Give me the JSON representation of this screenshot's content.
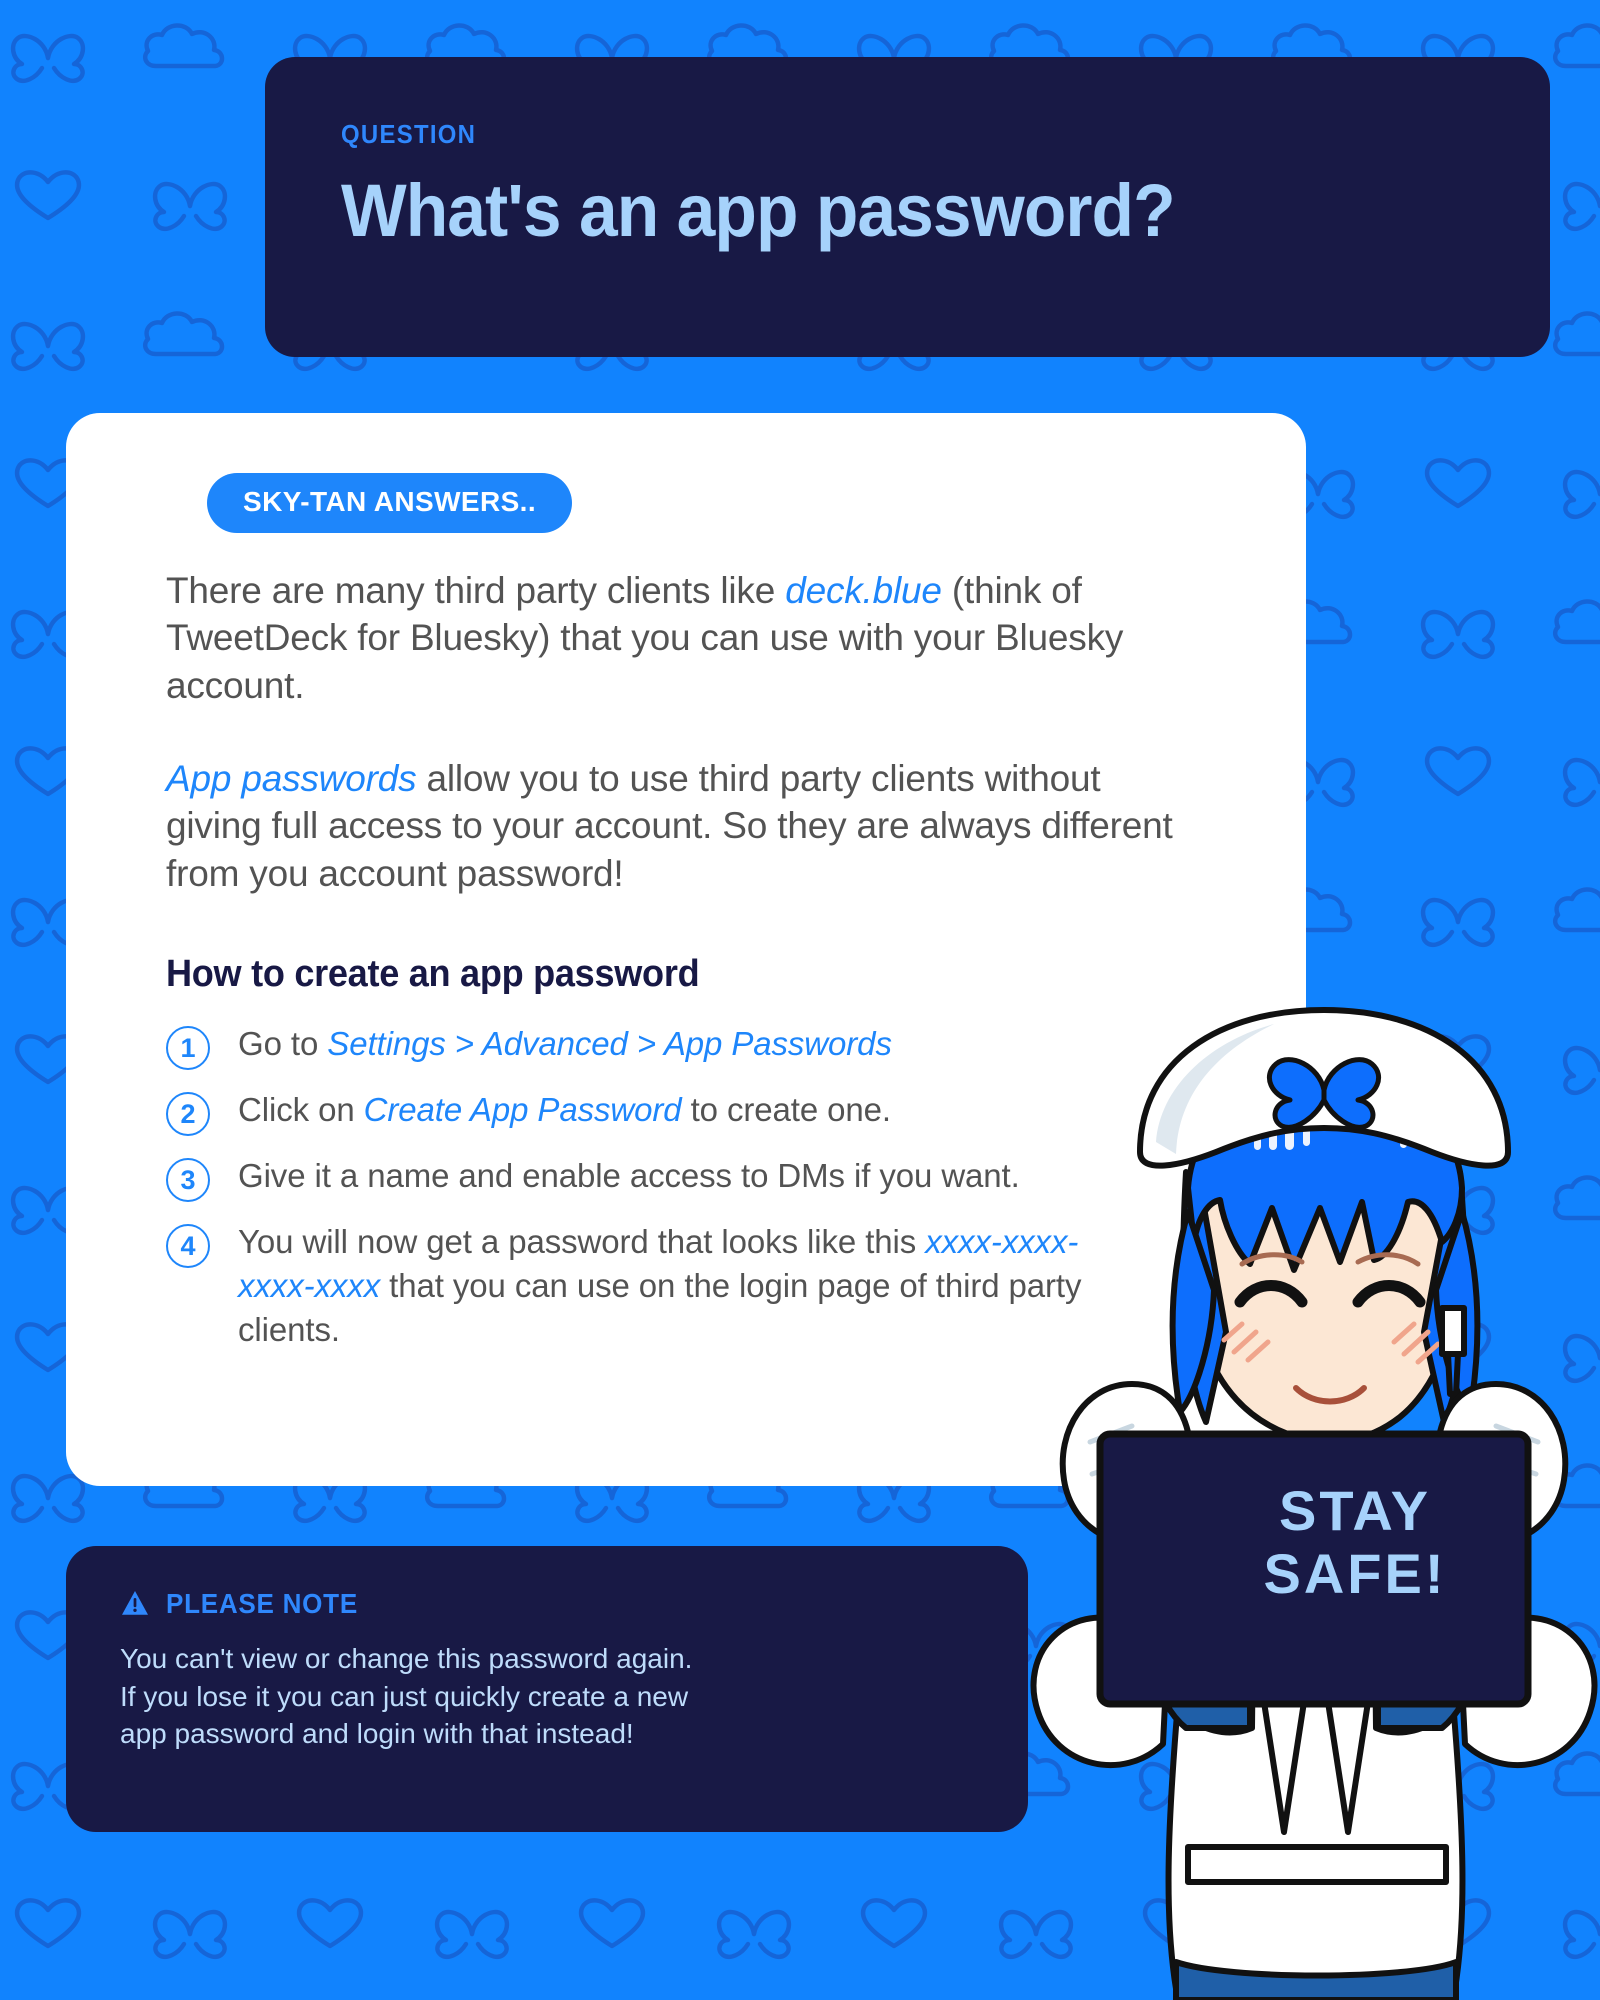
{
  "theme": {
    "background_blue": "#1183fe",
    "pattern_outline": "#1565d8",
    "navy": "#181945",
    "accent_blue": "#1e86fb",
    "light_blue_text": "#a6d2fb",
    "body_gray": "#535353",
    "card_white": "#ffffff"
  },
  "question_box": {
    "kicker": "QUESTION",
    "title": "What's an app password?"
  },
  "answer_card": {
    "badge": "SKY-TAN ANSWERS..",
    "paragraph_1": {
      "part_1": "There are many third party clients like ",
      "highlight": "deck.blue",
      "part_2": " (think of TweetDeck for Bluesky) that you can use with your Bluesky account."
    },
    "paragraph_2": {
      "highlight": "App passwords",
      "rest": " allow you to use third party clients without giving full access to your account. So they are always different from you account password!"
    },
    "steps_heading": "How to create an app password",
    "steps": [
      {
        "number": "1",
        "prefix": "Go to ",
        "highlight": "Settings > Advanced > App Passwords",
        "suffix": ""
      },
      {
        "number": "2",
        "prefix": "Click on ",
        "highlight": "Create App Password",
        "suffix": " to create one."
      },
      {
        "number": "3",
        "prefix": "Give it a name and enable access to DMs if you want.",
        "highlight": "",
        "suffix": ""
      },
      {
        "number": "4",
        "prefix": "You will now get a password that looks like this ",
        "highlight": "xxxx-xxxx-xxxx-xxxx",
        "suffix": " that you can use on the login page of third party clients."
      }
    ]
  },
  "note_box": {
    "icon": "warning-triangle-icon",
    "title": "PLEASE NOTE",
    "body": "You can't view or change this password again.\nIf you lose it you can just quickly create a new\napp password and login with that instead!"
  },
  "mascot": {
    "name": "sky-tan-mascot",
    "sign_text": "STAY\nSAFE!",
    "hat_emblem": "butterfly-icon"
  },
  "background": {
    "icons": [
      "butterfly-icon",
      "cloud-icon",
      "heart-icon"
    ]
  }
}
